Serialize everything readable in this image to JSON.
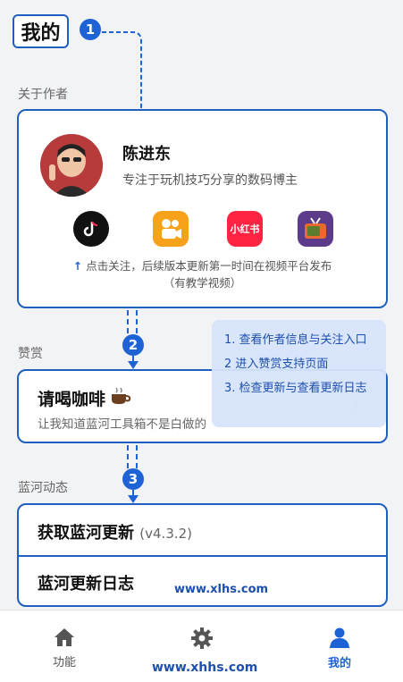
{
  "header": {
    "title": "我的"
  },
  "badges": [
    "1",
    "2",
    "3"
  ],
  "sections": {
    "about_author": "关于作者",
    "sponsor": "赞赏",
    "updates": "蓝河动态"
  },
  "author": {
    "name": "陈进东",
    "bio": "专注于玩机技巧分享的数码博主",
    "platforms": [
      {
        "name": "douyin-icon",
        "label": ""
      },
      {
        "name": "kuaishou-icon",
        "label": ""
      },
      {
        "name": "xiaohongshu-icon",
        "label": "小红书"
      },
      {
        "name": "tv-icon",
        "label": ""
      }
    ],
    "note_line1": "点击关注，后续版本更新第一时间在视频平台发布",
    "note_line2": "（有教学视频）"
  },
  "sponsor_card": {
    "title": "请喝咖啡",
    "subtitle": "让我知道蓝河工具箱不是白做的"
  },
  "tooltip": {
    "items": [
      "1. 查看作者信息与关注入口",
      "2  进入赞赏支持页面",
      "3. 检查更新与查看更新日志"
    ]
  },
  "updates_card": {
    "check_update": "获取蓝河更新",
    "version": "(v4.3.2)",
    "changelog": "蓝河更新日志"
  },
  "watermark": {
    "text1": "www.xlhs.com",
    "text2": "www.xhhs.com"
  },
  "tabbar": {
    "items": [
      {
        "label": "功能",
        "icon": "home-icon"
      },
      {
        "label": "设置",
        "icon": "gear-icon"
      },
      {
        "label": "我的",
        "icon": "user-icon"
      }
    ]
  },
  "colors": {
    "accent": "#1e63d6",
    "border": "#1f5fbf",
    "tooltip_bg": "#d6e4fa"
  }
}
